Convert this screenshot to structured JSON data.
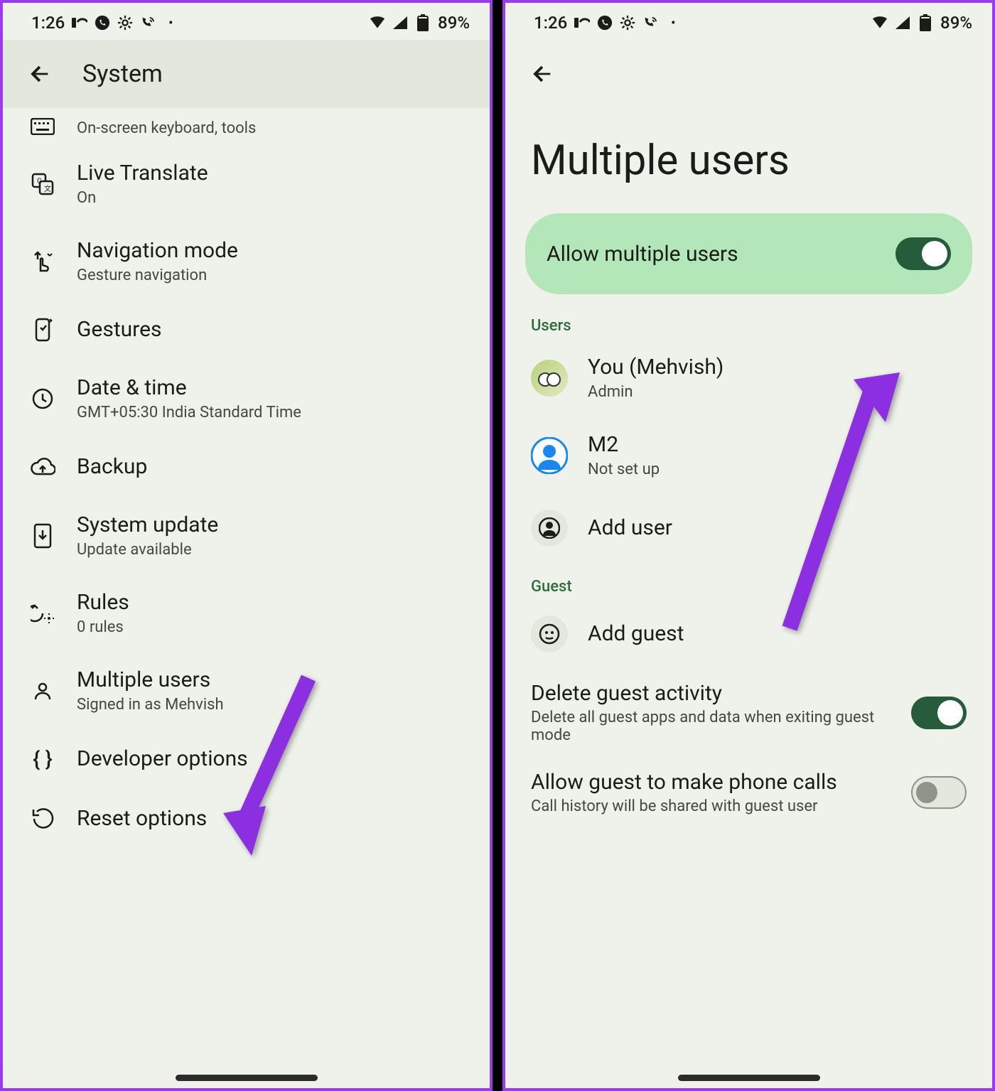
{
  "statusbar": {
    "time": "1:26",
    "battery": "89%"
  },
  "left": {
    "title": "System",
    "rows": [
      {
        "id": "keyboard",
        "title": "Keyboard",
        "sub": "On-screen keyboard, tools",
        "peek": true
      },
      {
        "id": "live-translate",
        "title": "Live Translate",
        "sub": "On"
      },
      {
        "id": "navigation-mode",
        "title": "Navigation mode",
        "sub": "Gesture navigation"
      },
      {
        "id": "gestures",
        "title": "Gestures",
        "sub": ""
      },
      {
        "id": "date-time",
        "title": "Date & time",
        "sub": "GMT+05:30 India Standard Time"
      },
      {
        "id": "backup",
        "title": "Backup",
        "sub": ""
      },
      {
        "id": "system-update",
        "title": "System update",
        "sub": "Update available"
      },
      {
        "id": "rules",
        "title": "Rules",
        "sub": "0 rules"
      },
      {
        "id": "multiple-users",
        "title": "Multiple users",
        "sub": "Signed in as Mehvish"
      },
      {
        "id": "developer-options",
        "title": "Developer options",
        "sub": ""
      },
      {
        "id": "reset-options",
        "title": "Reset options",
        "sub": ""
      }
    ]
  },
  "right": {
    "title": "Multiple users",
    "main_toggle": {
      "label": "Allow multiple users",
      "on": true
    },
    "section_users": "Users",
    "users": [
      {
        "id": "you",
        "title": "You (Mehvish)",
        "sub": "Admin"
      },
      {
        "id": "m2",
        "title": "M2",
        "sub": "Not set up"
      },
      {
        "id": "add-user",
        "title": "Add user",
        "sub": ""
      }
    ],
    "section_guest": "Guest",
    "guest": {
      "id": "add-guest",
      "title": "Add guest"
    },
    "delete_guest": {
      "title": "Delete guest activity",
      "sub": "Delete all guest apps and data when exiting guest mode",
      "on": true
    },
    "allow_calls": {
      "title": "Allow guest to make phone calls",
      "sub": "Call history will be shared with guest user",
      "on": false
    }
  },
  "annotation_color": "#8b2fe0"
}
